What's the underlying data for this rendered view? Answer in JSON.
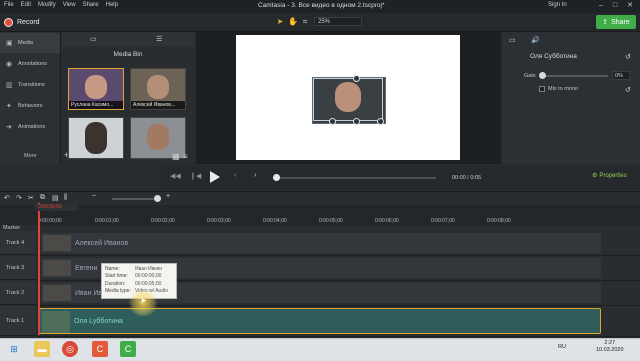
{
  "app": {
    "title": "Camtasia - 3. Все видео в одном 2.tscproj*",
    "menu": [
      "File",
      "Edit",
      "Modify",
      "View",
      "Share",
      "Help"
    ],
    "sign_in": "Sign In",
    "record_label": "Record",
    "share_label": "Share",
    "zoom_value": "25%"
  },
  "leftnav": {
    "items": [
      {
        "label": "Media",
        "icon": "media-icon"
      },
      {
        "label": "Annotations",
        "icon": "annotation-icon"
      },
      {
        "label": "Transitions",
        "icon": "transition-icon"
      },
      {
        "label": "Behaviors",
        "icon": "behavior-icon"
      },
      {
        "label": "Animations",
        "icon": "animation-icon"
      }
    ],
    "more_label": "More"
  },
  "media_bin": {
    "title": "Media Bin",
    "items": [
      {
        "label": "Руслана Касимо..."
      },
      {
        "label": "Алексей Иванов..."
      },
      {
        "label": ""
      },
      {
        "label": ""
      }
    ]
  },
  "properties": {
    "name": "Оля Субботина",
    "gain_label": "Gain",
    "gain_value": "0%",
    "gain_level": 0,
    "mix_label": "Mix to mono",
    "properties_button": "Properties"
  },
  "player": {
    "time_current": "00:00",
    "time_total": "0:05",
    "progress": 0
  },
  "timeline": {
    "playhead_label": "0:00:00;00",
    "ticks": [
      "0:00:00;00",
      "0:00:01;00",
      "0:00:02;00",
      "0:00:03;00",
      "0:00:04;00",
      "0:00:05;00",
      "0:00:06;00",
      "0:00:07;00",
      "0:00:08;00"
    ],
    "marker_label": "Marker",
    "tracks": [
      {
        "label": "Track 4",
        "clip": "Алексей Иванов"
      },
      {
        "label": "Track 3",
        "clip": "Евгени"
      },
      {
        "label": "Track 2",
        "clip": "Иван Ив"
      },
      {
        "label": "Track 1",
        "clip": "Оля Lyбботина"
      }
    ]
  },
  "tooltip": {
    "rows": [
      {
        "key": "Name:",
        "value": "Иван Ивкин"
      },
      {
        "key": "Start time:",
        "value": "00:00:00;00"
      },
      {
        "key": "Duration:",
        "value": "00:00:05;00"
      },
      {
        "key": "Media type:",
        "value": "Video w/ Audio"
      }
    ]
  },
  "taskbar": {
    "lang": "RU",
    "time": "2:27",
    "date": "10.03.2020"
  },
  "colors": {
    "accent_green": "#3fae49",
    "record_red": "#e04b3a",
    "playhead_red": "#e0453a",
    "selection_yellow": "#e0a530"
  }
}
